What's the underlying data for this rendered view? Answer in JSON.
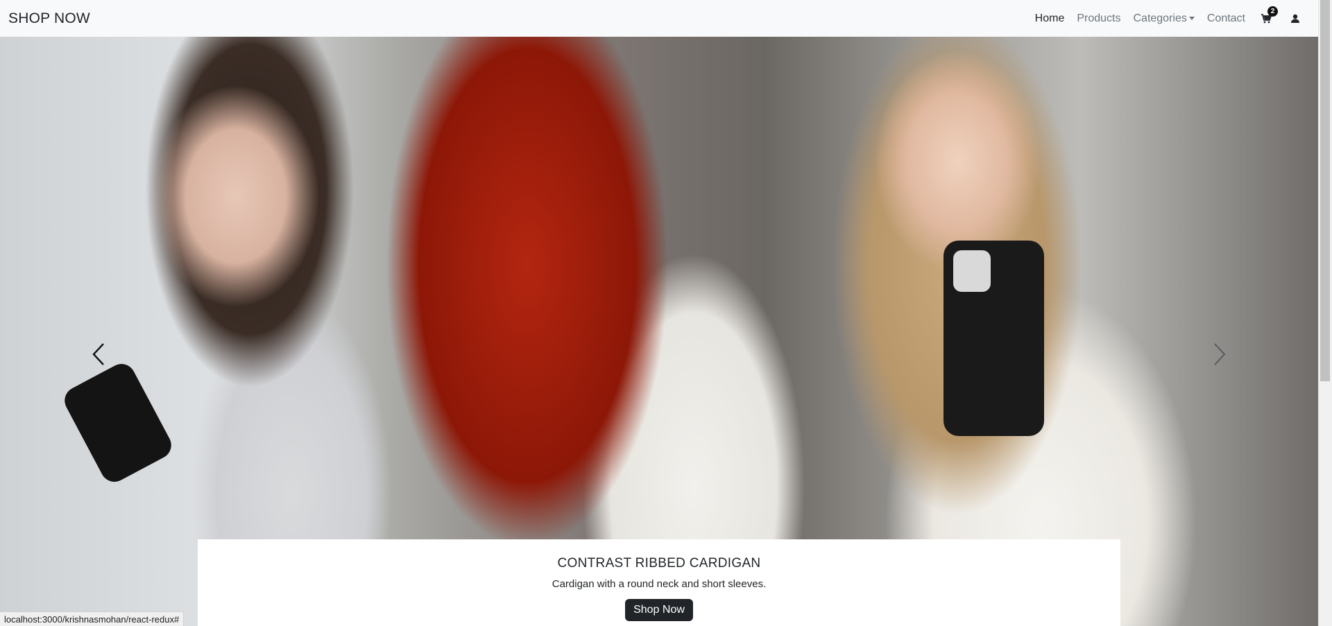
{
  "navbar": {
    "brand": "SHOP NOW",
    "links": [
      {
        "label": "Home"
      },
      {
        "label": "Products"
      },
      {
        "label": "Categories"
      },
      {
        "label": "Contact"
      }
    ],
    "cart_count": "2"
  },
  "hero": {
    "caption_title": "CONTRAST RIBBED CARDIGAN",
    "caption_text": "Cardigan with a round neck and short sleeves.",
    "button_label": "Shop Now"
  },
  "status_bar": {
    "url": "localhost:3000/krishnasmohan/react-redux#"
  },
  "colors": {
    "navbar_bg": "#f8f9fa",
    "text_dark": "#212529",
    "text_muted": "#6c757d",
    "button_bg": "#212529"
  },
  "icons": [
    "cart-icon",
    "user-icon",
    "chevron-left-icon",
    "chevron-right-icon",
    "caret-down-icon"
  ]
}
